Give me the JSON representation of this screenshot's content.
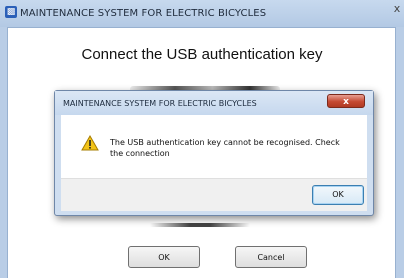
{
  "window": {
    "title": "MAINTENANCE SYSTEM FOR ELECTRIC BICYCLES",
    "close_glyph": "x",
    "heading": "Connect the USB authentication key",
    "ok_label": "OK",
    "cancel_label": "Cancel"
  },
  "dialog": {
    "title": "MAINTENANCE SYSTEM FOR ELECTRIC BICYCLES",
    "close_glyph": "x",
    "icon": "warning-icon",
    "message": "The USB authentication key cannot be recognised. Check the connection",
    "ok_label": "OK"
  },
  "colors": {
    "titlebar": "#c7d9ee",
    "dialog_close": "#c54a33",
    "warning_yellow": "#f2c318"
  }
}
